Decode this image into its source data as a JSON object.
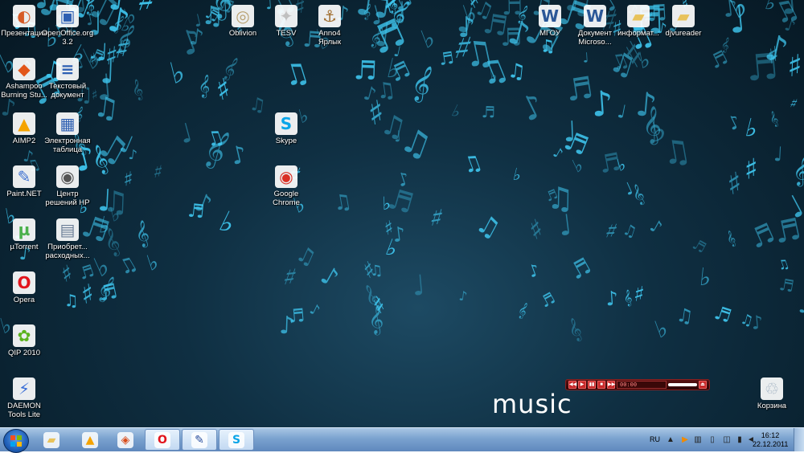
{
  "desktop": {
    "wallpaper_text": "music",
    "wallpaper_colors": {
      "background": "#0f2f42",
      "notes": "#3fc7f0"
    },
    "icons": [
      {
        "name": "presentation",
        "label": "Презентация",
        "glyph": "◐",
        "color": "#d65b27",
        "icon": "presentation-icon"
      },
      {
        "name": "openoffice",
        "label": "OpenOffice.org\n3.2",
        "glyph": "▣",
        "color": "#2d5fb2",
        "icon": "openoffice-icon"
      },
      {
        "name": "oblivion",
        "label": "Oblivion",
        "glyph": "◎",
        "color": "#b8a070",
        "icon": "oblivion-icon"
      },
      {
        "name": "tesv",
        "label": "TESV",
        "glyph": "✦",
        "color": "#c0c0c0",
        "icon": "skyrim-icon"
      },
      {
        "name": "anno4",
        "label": "Anno4\nЯрлык",
        "glyph": "⚓",
        "color": "#a06d2d",
        "icon": "anno-icon"
      },
      {
        "name": "mgou",
        "label": "МГОУ",
        "glyph": "W",
        "color": "#2b5797",
        "icon": "word-document-icon"
      },
      {
        "name": "word-doc",
        "label": "Документ\nMicroso...",
        "glyph": "W",
        "color": "#2b5797",
        "icon": "word-document-icon"
      },
      {
        "name": "informat",
        "label": "информат...",
        "glyph": "▰",
        "color": "#e8c25a",
        "icon": "folder-icon"
      },
      {
        "name": "djvureader",
        "label": "djvureader",
        "glyph": "▰",
        "color": "#e8c25a",
        "icon": "folder-icon"
      },
      {
        "name": "ashampoo",
        "label": "Ashampoo\nBurning Stu...",
        "glyph": "◆",
        "color": "#e2561a",
        "icon": "ashampoo-icon"
      },
      {
        "name": "text-doc",
        "label": "Текстовый\nдокумент",
        "glyph": "≡",
        "color": "#2d5fb2",
        "icon": "text-document-icon"
      },
      {
        "name": "aimp2",
        "label": "AIMP2",
        "glyph": "▲",
        "color": "#f5a300",
        "icon": "aimp-icon"
      },
      {
        "name": "spreadsheet",
        "label": "Электронная\nтаблица",
        "glyph": "▦",
        "color": "#2d5fb2",
        "icon": "spreadsheet-icon"
      },
      {
        "name": "skype",
        "label": "Skype",
        "glyph": "S",
        "color": "#0aa5e8",
        "icon": "skype-icon"
      },
      {
        "name": "paintnet",
        "label": "Paint.NET",
        "glyph": "✎",
        "color": "#3b6fd0",
        "icon": "paintnet-icon"
      },
      {
        "name": "hp-center",
        "label": "Центр\nрешений HP",
        "glyph": "◉",
        "color": "#555555",
        "icon": "hp-solution-center-icon"
      },
      {
        "name": "chrome",
        "label": "Google\nChrome",
        "glyph": "◉",
        "color": "#d93025",
        "icon": "chrome-icon"
      },
      {
        "name": "utorrent",
        "label": "µTorrent",
        "glyph": "µ",
        "color": "#4bb04b",
        "icon": "utorrent-icon"
      },
      {
        "name": "acquire",
        "label": "Приобрет...\nрасходных...",
        "glyph": "▤",
        "color": "#6a7d96",
        "icon": "hp-supplies-icon"
      },
      {
        "name": "opera",
        "label": "Opera",
        "glyph": "O",
        "color": "#e2141c",
        "icon": "opera-icon"
      },
      {
        "name": "qip",
        "label": "QIP 2010",
        "glyph": "✿",
        "color": "#5bb31d",
        "icon": "qip-icon"
      },
      {
        "name": "daemon",
        "label": "DAEMON\nTools Lite",
        "glyph": "⚡",
        "color": "#3a6ed6",
        "icon": "daemon-tools-icon"
      },
      {
        "name": "recycle-bin",
        "label": "Корзина",
        "glyph": "♲",
        "color": "#9fb0c0",
        "icon": "recycle-bin-icon"
      }
    ]
  },
  "player": {
    "display_text": "00:00",
    "buttons": [
      "◀◀",
      "▶",
      "▮▮",
      "■",
      "▶▶",
      "⏏"
    ]
  },
  "taskbar": {
    "pinned": [
      {
        "name": "explorer",
        "glyph": "▰",
        "color": "#e8c25a",
        "icon": "explorer-folder-icon",
        "active": false
      },
      {
        "name": "aimp",
        "glyph": "▲",
        "color": "#f5a300",
        "icon": "aimp-icon",
        "active": false
      },
      {
        "name": "media",
        "glyph": "◈",
        "color": "#d94c1a",
        "icon": "media-player-icon",
        "active": false
      },
      {
        "name": "opera",
        "glyph": "O",
        "color": "#e2141c",
        "icon": "opera-icon",
        "active": true
      },
      {
        "name": "paint",
        "glyph": "✎",
        "color": "#2b4f9e",
        "icon": "paint-icon",
        "active": true
      },
      {
        "name": "skype",
        "glyph": "S",
        "color": "#0aa5e8",
        "icon": "skype-icon",
        "active": true
      }
    ],
    "language": "RU",
    "clock_time": "16:12",
    "clock_date": "22.12.2011",
    "tray": [
      {
        "name": "tray-show-hidden",
        "glyph": "▲",
        "icon": "chevron-up-icon"
      },
      {
        "name": "tray-media",
        "glyph": "▶",
        "icon": "media-tray-icon"
      },
      {
        "name": "tray-network-1",
        "glyph": "▥",
        "icon": "network-icon"
      },
      {
        "name": "tray-device",
        "glyph": "▯",
        "icon": "device-icon"
      },
      {
        "name": "tray-safely-remove",
        "glyph": "◫",
        "icon": "usb-icon"
      },
      {
        "name": "tray-power",
        "glyph": "▮",
        "icon": "battery-icon"
      },
      {
        "name": "tray-volume",
        "glyph": "◄",
        "icon": "volume-icon"
      }
    ]
  }
}
